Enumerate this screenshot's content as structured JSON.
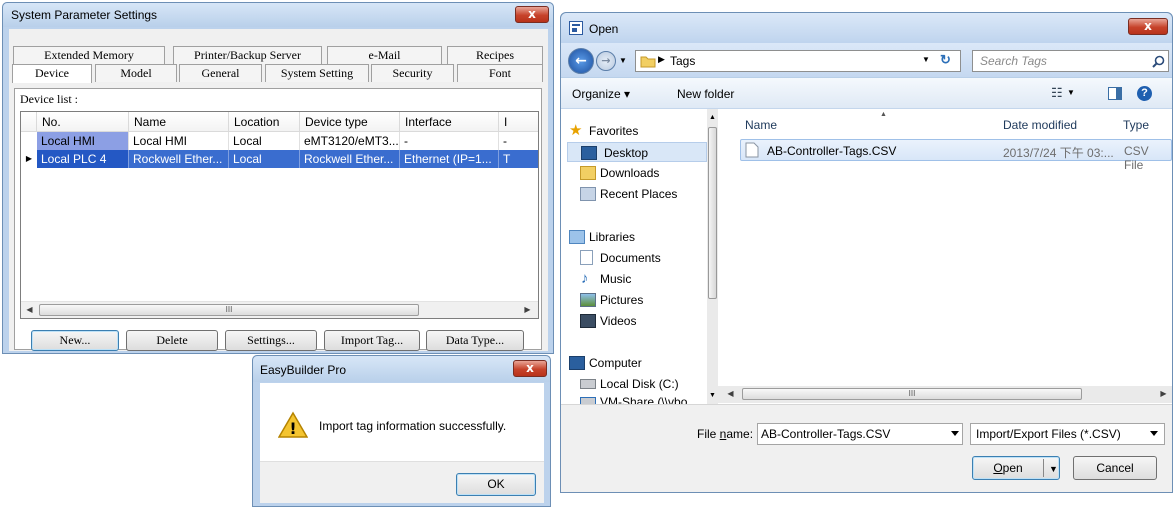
{
  "sps": {
    "title": "System Parameter Settings",
    "close": "x",
    "tabs_row1": [
      "Extended Memory",
      "Printer/Backup Server",
      "e-Mail",
      "Recipes"
    ],
    "tabs_row2": [
      "Device",
      "Model",
      "General",
      "System Setting",
      "Security",
      "Font"
    ],
    "device_list_label": "Device list :",
    "columns": [
      "No.",
      "Name",
      "Location",
      "Device type",
      "Interface",
      "I"
    ],
    "rows": [
      [
        "Local HMI",
        "Local HMI",
        "Local",
        "eMT3120/eMT3...",
        "-",
        "-"
      ],
      [
        "Local PLC 4",
        "Rockwell Ether...",
        "Local",
        "Rockwell Ether...",
        "Ethernet (IP=1...",
        "T"
      ]
    ],
    "scroll_thumb": "III",
    "buttons": {
      "new": "New...",
      "delete": "Delete",
      "settings": "Settings...",
      "import_tag": "Import Tag...",
      "data_type": "Data Type..."
    }
  },
  "ebp": {
    "title": "EasyBuilder Pro",
    "close": "x",
    "message": "Import tag information successfully.",
    "warning_glyph": "!",
    "ok": "OK"
  },
  "open": {
    "title": "Open",
    "close": "x",
    "breadcrumb": "Tags",
    "search_placeholder": "Search Tags",
    "toolbar": {
      "organize": "Organize ▾",
      "new_folder": "New folder"
    },
    "nav": {
      "favorites": "Favorites",
      "desktop": "Desktop",
      "downloads": "Downloads",
      "recent": "Recent Places",
      "libraries": "Libraries",
      "documents": "Documents",
      "music": "Music",
      "pictures": "Pictures",
      "videos": "Videos",
      "computer": "Computer",
      "local_disk": "Local Disk (C:)",
      "vm_share": "VM-Share (\\\\vbo"
    },
    "columns": {
      "name": "Name",
      "date": "Date modified",
      "type": "Type"
    },
    "file": {
      "name": "AB-Controller-Tags.CSV",
      "date": "2013/7/24 下午 03:...",
      "type": "CSV File"
    },
    "hscroll_thumb": "III",
    "file_name_label_pre": "File ",
    "file_name_label_u": "n",
    "file_name_label_post": "ame:",
    "file_name_value": "AB-Controller-Tags.CSV",
    "filter": "Import/Export Files (*.CSV)",
    "open_btn_u": "O",
    "open_btn_rest": "pen",
    "cancel_btn": "Cancel"
  },
  "colors": {
    "selection": "#3a6dcf",
    "hmi_cell": "#8c9fe4",
    "title_gradient": "#c3d7ef",
    "close_red": "#c7432b"
  }
}
